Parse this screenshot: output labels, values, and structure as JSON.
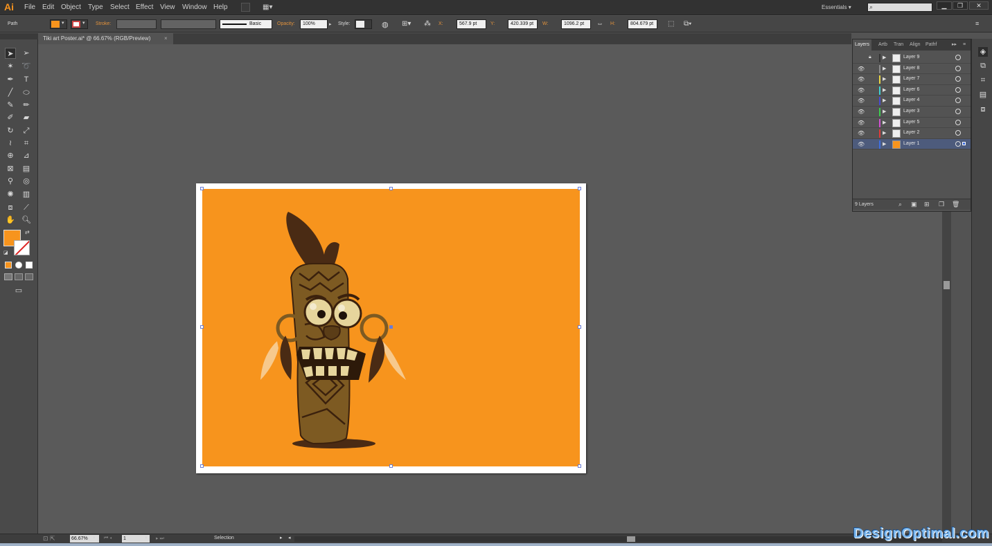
{
  "app": {
    "logo": "Ai"
  },
  "menu": [
    "File",
    "Edit",
    "Object",
    "Type",
    "Select",
    "Effect",
    "View",
    "Window",
    "Help"
  ],
  "workspace": "Essentials",
  "search": {
    "placeholder": ""
  },
  "control": {
    "selection_type": "Path",
    "stroke_label": "Stroke:",
    "brush": "Basic",
    "opacity_label": "Opacity:",
    "opacity": "100%",
    "style_label": "Style:",
    "x_label": "X:",
    "x": "567.9 pt",
    "y_label": "Y:",
    "y": "420.339 pt",
    "w_label": "W:",
    "w": "1096.2 pt",
    "h_label": "H:",
    "h": "804.679 pt"
  },
  "document_tab": {
    "title": "Tiki art Poster.ai* @ 66.67% (RGB/Preview)",
    "close": "×"
  },
  "layers_panel": {
    "tabs": [
      "Layers",
      "Artb",
      "Tran",
      "Align",
      "Pathf"
    ],
    "layers": [
      {
        "name": "Layer 9",
        "color": "#333333",
        "visible": false,
        "locked": true,
        "selected": false
      },
      {
        "name": "Layer 8",
        "color": "#8c8c8c",
        "visible": true,
        "locked": false,
        "selected": false
      },
      {
        "name": "Layer 7",
        "color": "#e8d544",
        "visible": true,
        "locked": false,
        "selected": false
      },
      {
        "name": "Layer 6",
        "color": "#3fd0d0",
        "visible": true,
        "locked": false,
        "selected": false
      },
      {
        "name": "Layer 4",
        "color": "#4a4ad0",
        "visible": true,
        "locked": false,
        "selected": false
      },
      {
        "name": "Layer 3",
        "color": "#3dcc4e",
        "visible": true,
        "locked": false,
        "selected": false
      },
      {
        "name": "Layer 5",
        "color": "#d24fd2",
        "visible": true,
        "locked": false,
        "selected": false
      },
      {
        "name": "Layer 2",
        "color": "#e03a3a",
        "visible": true,
        "locked": false,
        "selected": false
      },
      {
        "name": "Layer 1",
        "color": "#3f6fe0",
        "visible": true,
        "locked": false,
        "selected": true
      }
    ],
    "count": "9 Layers"
  },
  "status": {
    "zoom": "66.67%",
    "artboard": "1",
    "tool": "Selection"
  },
  "colors": {
    "fill": "#f7941d",
    "artwork_bg": "#f7941d",
    "tiki_dark": "#4a2b14",
    "tiki_mid": "#7d5a22",
    "tiki_light": "#e6d59c",
    "feather": "#f7c98c"
  },
  "watermark": "DesignOptimal.com"
}
